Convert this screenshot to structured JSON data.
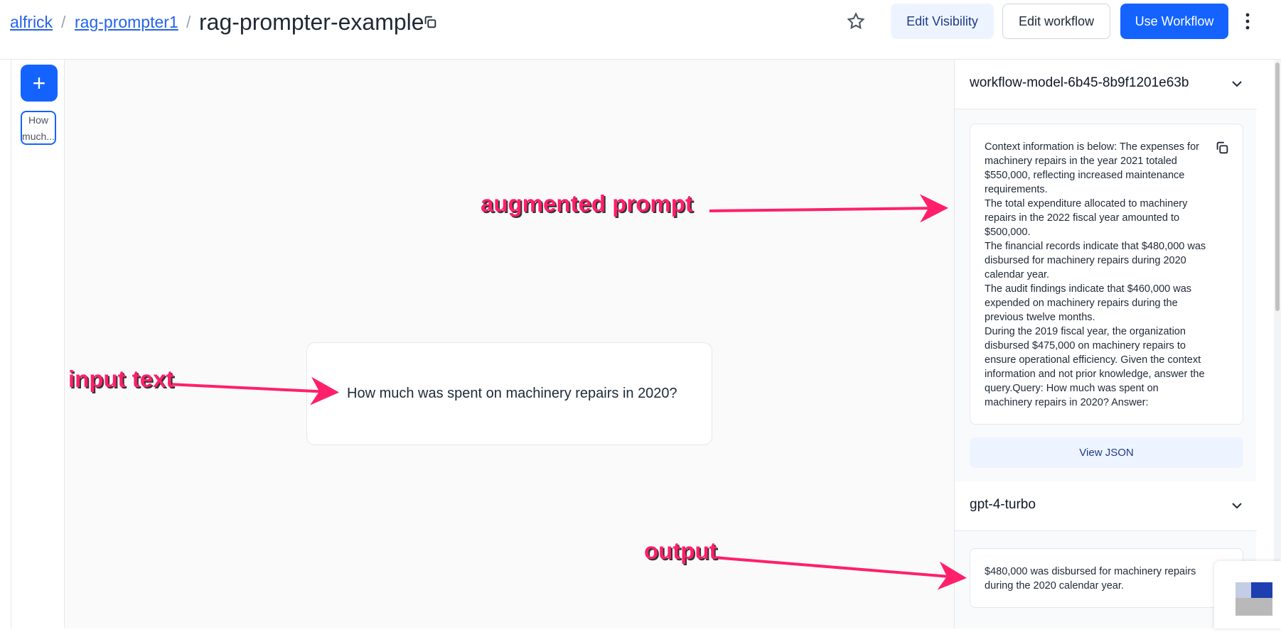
{
  "header": {
    "breadcrumb": [
      "alfrick",
      "rag-prompter1"
    ],
    "separator": "/",
    "title": "rag-prompter-example",
    "buttons": {
      "edit_visibility": "Edit Visibility",
      "edit_workflow": "Edit workflow",
      "use_workflow": "Use Workflow"
    }
  },
  "sidebar": {
    "add_label": "+",
    "mini_card_text": "How much..."
  },
  "canvas": {
    "input_text": "How much was spent on machinery repairs in 2020?"
  },
  "panel": {
    "sections": [
      {
        "title": "workflow-model-6b45-8b9f1201e63b",
        "paragraphs": [
          "Context information is below: The expenses for machinery repairs in the year 2021 totaled $550,000, reflecting increased maintenance requirements.",
          "The total expenditure allocated to machinery repairs in the 2022 fiscal year amounted to $500,000.",
          "The financial records indicate that $480,000 was disbursed for machinery repairs during 2020 calendar year.",
          "The audit findings indicate that $460,000 was expended on machinery repairs during the previous twelve months.",
          "During the 2019 fiscal year, the organization disbursed $475,000 on machinery repairs to ensure operational efficiency.  Given the context information and not prior knowledge, answer the query.Query: How much was spent on machinery repairs in 2020? Answer:"
        ],
        "view_json": "View JSON"
      },
      {
        "title": "gpt-4-turbo",
        "paragraphs": [
          "$480,000 was disbursed for machinery repairs during the 2020 calendar year."
        ]
      }
    ]
  },
  "annotations": {
    "augmented": "augmented prompt",
    "input": "input text",
    "output": "output"
  },
  "colors": {
    "primary": "#1463ff",
    "annotation": "#ff1f6a"
  }
}
